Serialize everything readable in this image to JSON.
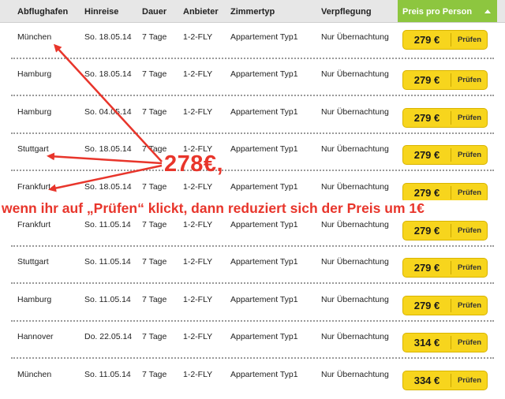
{
  "columns": [
    "Abflughafen",
    "Hinreise",
    "Dauer",
    "Anbieter",
    "Zimmertyp",
    "Verpflegung",
    "Preis pro Person"
  ],
  "button_label": "Prüfen",
  "rows": [
    {
      "airport": "München",
      "date": "So. 18.05.14",
      "duration": "7 Tage",
      "provider": "1-2-FLY",
      "room": "Appartement Typ1",
      "board": "Nur Übernachtung",
      "price": "279 €"
    },
    {
      "airport": "Hamburg",
      "date": "So. 18.05.14",
      "duration": "7 Tage",
      "provider": "1-2-FLY",
      "room": "Appartement Typ1",
      "board": "Nur Übernachtung",
      "price": "279 €"
    },
    {
      "airport": "Hamburg",
      "date": "So. 04.05.14",
      "duration": "7 Tage",
      "provider": "1-2-FLY",
      "room": "Appartement Typ1",
      "board": "Nur Übernachtung",
      "price": "279 €"
    },
    {
      "airport": "Stuttgart",
      "date": "So. 18.05.14",
      "duration": "7 Tage",
      "provider": "1-2-FLY",
      "room": "Appartement Typ1",
      "board": "Nur Übernachtung",
      "price": "279 €"
    },
    {
      "airport": "Frankfurt",
      "date": "So. 18.05.14",
      "duration": "7 Tage",
      "provider": "1-2-FLY",
      "room": "Appartement Typ1",
      "board": "Nur Übernachtung",
      "price": "279 €"
    },
    {
      "airport": "Frankfurt",
      "date": "So. 11.05.14",
      "duration": "7 Tage",
      "provider": "1-2-FLY",
      "room": "Appartement Typ1",
      "board": "Nur Übernachtung",
      "price": "279 €"
    },
    {
      "airport": "Stuttgart",
      "date": "So. 11.05.14",
      "duration": "7 Tage",
      "provider": "1-2-FLY",
      "room": "Appartement Typ1",
      "board": "Nur Übernachtung",
      "price": "279 €"
    },
    {
      "airport": "Hamburg",
      "date": "So. 11.05.14",
      "duration": "7 Tage",
      "provider": "1-2-FLY",
      "room": "Appartement Typ1",
      "board": "Nur Übernachtung",
      "price": "279 €"
    },
    {
      "airport": "Hannover",
      "date": "Do. 22.05.14",
      "duration": "7 Tage",
      "provider": "1-2-FLY",
      "room": "Appartement Typ1",
      "board": "Nur Übernachtung",
      "price": "314 €"
    },
    {
      "airport": "München",
      "date": "So. 11.05.14",
      "duration": "7 Tage",
      "provider": "1-2-FLY",
      "room": "Appartement Typ1",
      "board": "Nur Übernachtung",
      "price": "334 €"
    }
  ],
  "annotation": {
    "price": "278€,",
    "text": "wenn ihr auf „Prüfen“ klickt, dann reduziert sich der Preis um 1€"
  },
  "colors": {
    "header_bg": "#e7e7e7",
    "price_header": "#8dc63f",
    "button": "#f7d51d",
    "annotation": "#e8352b"
  }
}
